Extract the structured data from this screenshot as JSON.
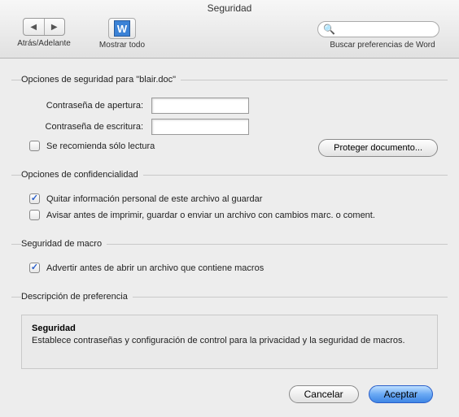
{
  "title": "Seguridad",
  "toolbar": {
    "back_forward_label": "Atrás/Adelante",
    "show_all_label": "Mostrar todo",
    "search_placeholder": "",
    "search_label": "Buscar preferencias de Word"
  },
  "security_options": {
    "legend": "Opciones de seguridad para \"blair.doc\"",
    "open_pw_label": "Contraseña de apertura:",
    "open_pw_value": "",
    "write_pw_label": "Contraseña de escritura:",
    "write_pw_value": "",
    "readonly_label": "Se recomienda sólo lectura",
    "readonly_checked": false,
    "protect_btn": "Proteger documento..."
  },
  "privacy": {
    "legend": "Opciones de confidencialidad",
    "remove_personal_label": "Quitar información personal de este archivo al guardar",
    "remove_personal_checked": true,
    "warn_changes_label": "Avisar antes de imprimir, guardar o enviar un archivo con cambios marc. o coment.",
    "warn_changes_checked": false
  },
  "macro": {
    "legend": "Seguridad de macro",
    "warn_macros_label": "Advertir antes de abrir un archivo que contiene macros",
    "warn_macros_checked": true
  },
  "description": {
    "legend": "Descripción de preferencia",
    "title": "Seguridad",
    "body": "Establece contraseñas y configuración de control para la privacidad y la seguridad de macros."
  },
  "footer": {
    "cancel": "Cancelar",
    "ok": "Aceptar"
  }
}
